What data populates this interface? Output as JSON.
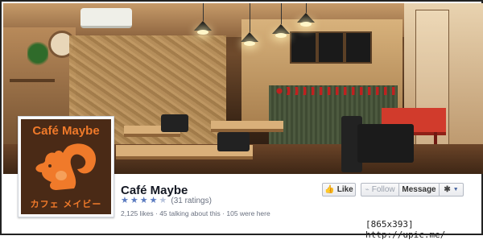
{
  "page": {
    "name": "Café Maybe",
    "rating": {
      "stars": 4,
      "max_stars": 5,
      "count_text": "(31 ratings)"
    },
    "stats": {
      "likes": "2,125 likes",
      "sep1": " · ",
      "talking": "45 talking about this",
      "sep2": " · ",
      "visits": "105 were here"
    }
  },
  "profile_logo": {
    "title": "Café Maybe",
    "subtitle": "カフェ メイビー",
    "color": "#f07a2a",
    "background": "#4a2a16"
  },
  "actions": {
    "like_label": "Like",
    "follow_label": "Follow",
    "message_label": "Message"
  },
  "icons": {
    "like": "thumbs-up-icon",
    "follow": "rss-icon",
    "settings": "gear-icon",
    "dropdown": "caret-down-icon"
  },
  "watermark": "[865x393] http://upic.me/",
  "colors": {
    "link_blue": "#4b67a1",
    "star_blue": "#5b7bc0",
    "text_gray": "#6a7180"
  }
}
